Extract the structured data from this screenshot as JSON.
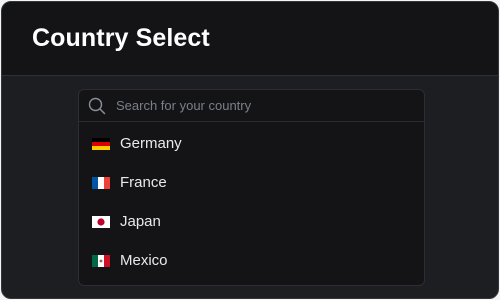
{
  "header": {
    "title": "Country Select"
  },
  "search": {
    "placeholder": "Search for your country",
    "icon": "search-icon"
  },
  "countries": [
    {
      "name": "Germany",
      "flag": "flag-de-icon"
    },
    {
      "name": "France",
      "flag": "flag-fr-icon"
    },
    {
      "name": "Japan",
      "flag": "flag-jp-icon"
    },
    {
      "name": "Mexico",
      "flag": "flag-mx-icon"
    }
  ],
  "colors": {
    "background": "#1d1e22",
    "header_bg": "#141417",
    "panel_bg": "#141417",
    "text": "#e8e9ec",
    "placeholder": "#7b7f88"
  }
}
